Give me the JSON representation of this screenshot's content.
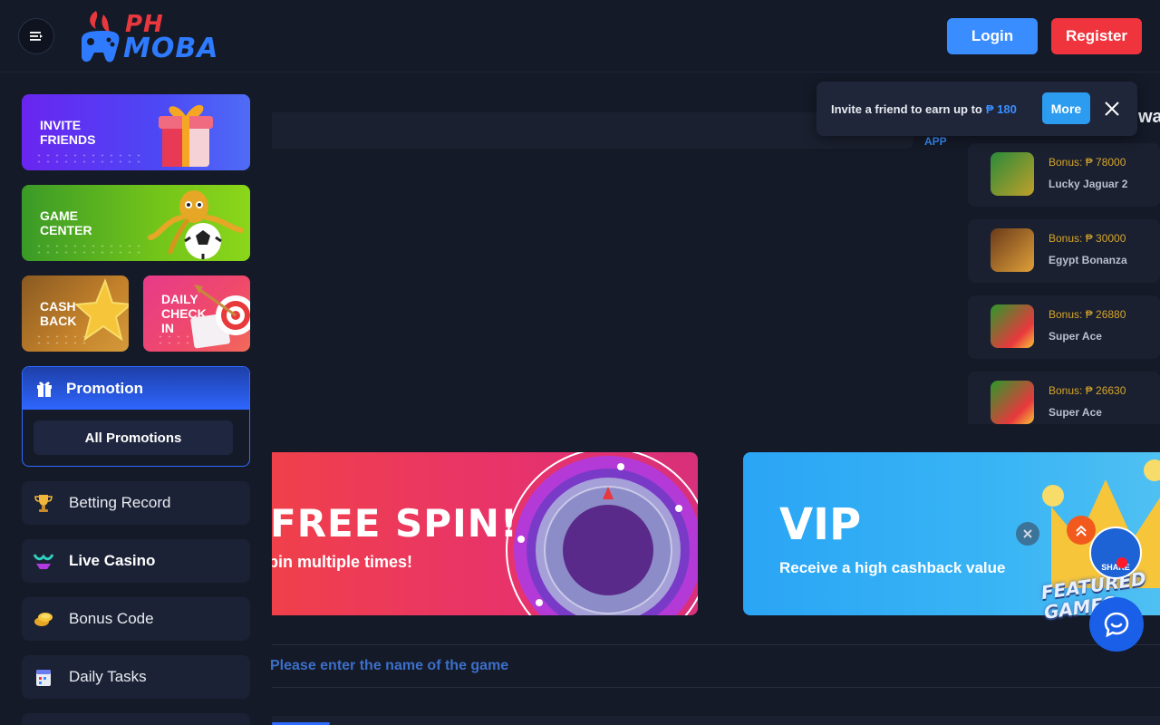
{
  "header": {
    "logo_line1": "PH",
    "logo_line2": "MOBA",
    "login_label": "Login",
    "register_label": "Register"
  },
  "sidebar": {
    "cards": {
      "invite": "INVITE\nFRIENDS",
      "game_center": "GAME\nCENTER",
      "cash_back": "CASH\nBACK",
      "daily_check_in": "DAILY\nCHECK\nIN"
    },
    "promotion": {
      "title": "Promotion",
      "all_label": "All Promotions"
    },
    "items": [
      {
        "label": "Betting Record",
        "icon": "trophy-icon"
      },
      {
        "label": "Live Casino",
        "icon": "bikini-icon"
      },
      {
        "label": "Bonus Code",
        "icon": "coins-icon"
      },
      {
        "label": "Daily Tasks",
        "icon": "calendar-icon"
      }
    ]
  },
  "main": {
    "app_label": "APP",
    "toast": {
      "message": "Invite a friend to earn up to",
      "amount": "₱ 180",
      "more_label": "More"
    },
    "wins": {
      "title_fragment": "wa",
      "items": [
        {
          "bonus": "Bonus: ₱ 78000",
          "name": "Lucky Jaguar 2"
        },
        {
          "bonus": "Bonus: ₱ 30000",
          "name": "Egypt Bonanza"
        },
        {
          "bonus": "Bonus: ₱ 26880",
          "name": "Super Ace"
        },
        {
          "bonus": "Bonus: ₱ 26630",
          "name": "Super Ace"
        }
      ]
    },
    "banners": {
      "spin_title": "FREE SPIN!",
      "spin_subtitle": "pin multiple times!",
      "vip_title": "VIP",
      "vip_subtitle": "Receive a high cashback value"
    },
    "search": {
      "placeholder": "Please enter the name of the game"
    },
    "floating": {
      "share_label": "SHARE",
      "featured_label": "FEATURED\nGAMES"
    }
  },
  "colors": {
    "background": "#151a28",
    "login": "#3a8dff",
    "register": "#f0343d",
    "accent": "#2e6bff",
    "bonus": "#d4a52a"
  }
}
